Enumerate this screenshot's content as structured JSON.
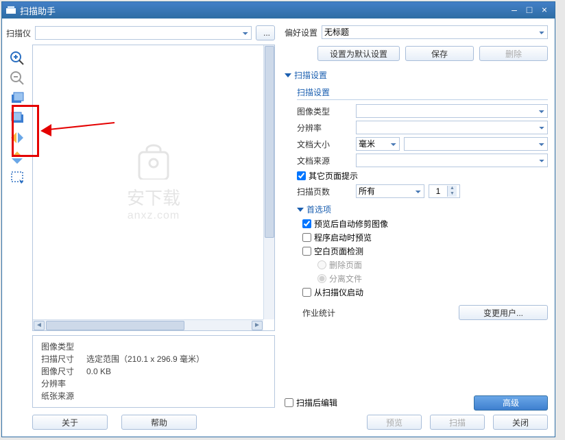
{
  "title": "扫描助手",
  "left": {
    "scannerLabel": "扫描仪",
    "browseBtn": "...",
    "info": {
      "imgType": "图像类型",
      "scanSize": "扫描尺寸",
      "scanSizeVal": "选定范围（210.1 x 296.9 毫米）",
      "imgSize": "图像尺寸",
      "imgSizeVal": "0.0 KB",
      "resolution": "分辨率",
      "paperSource": "纸张来源"
    },
    "aboutBtn": "关于",
    "helpBtn": "帮助"
  },
  "right": {
    "prefLabel": "偏好设置",
    "prefValue": "无标题",
    "setDefaultBtn": "设置为默认设置",
    "saveBtn": "保存",
    "deleteBtn": "删除",
    "scanSettings": "扫描设置",
    "scanSettingsSub": "扫描设置",
    "imgType": "图像类型",
    "resolution": "分辨率",
    "docSize": "文档大小",
    "docUnit": "毫米",
    "docSource": "文档来源",
    "otherPage": "其它页面提示",
    "scanPages": "扫描页数",
    "scanPagesAll": "所有",
    "scanPagesNum": "1",
    "prefsHdr": "首选项",
    "autoTrim": "预览后自动修剪图像",
    "previewOnLaunch": "程序启动时预览",
    "blankDetect": "空白页面检测",
    "delPage": "删除页面",
    "splitFile": "分离文件",
    "scannerLaunch": "从扫描仪启动",
    "jobStats": "作业统计",
    "changeUser": "变更用户...",
    "editAfter": "扫描后编辑",
    "advanced": "高级",
    "previewBtn": "预览",
    "scanBtn": "扫描",
    "closeBtn": "关闭"
  },
  "watermark": {
    "t1": "安下载",
    "t2": "anxz.com"
  }
}
